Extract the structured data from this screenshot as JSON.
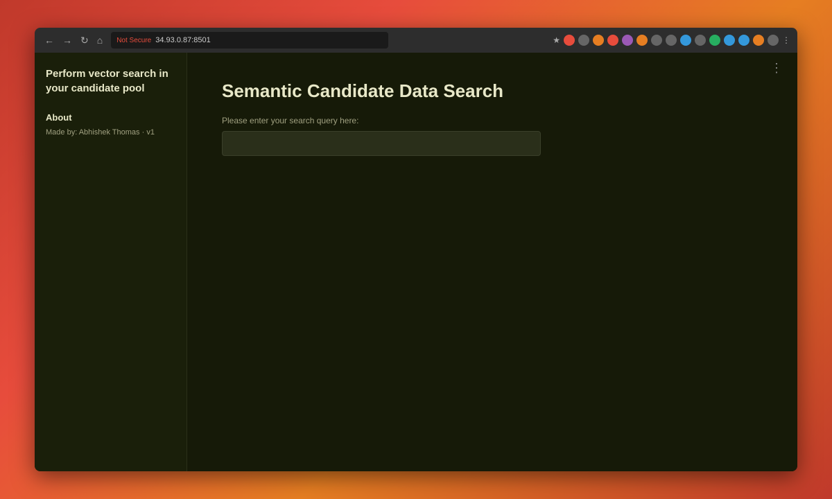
{
  "browser": {
    "url": "34.93.0.87:8501",
    "not_secure_label": "Not Secure",
    "three_dots_label": "⋮"
  },
  "sidebar": {
    "title": "Perform vector search in your candidate pool",
    "about_label": "About",
    "made_by_label": "Made by: Abhishek Thomas · v1"
  },
  "main": {
    "page_title": "Semantic Candidate Data Search",
    "search_label": "Please enter your search query here:",
    "search_placeholder": "",
    "three_dots_icon": "⋮"
  }
}
